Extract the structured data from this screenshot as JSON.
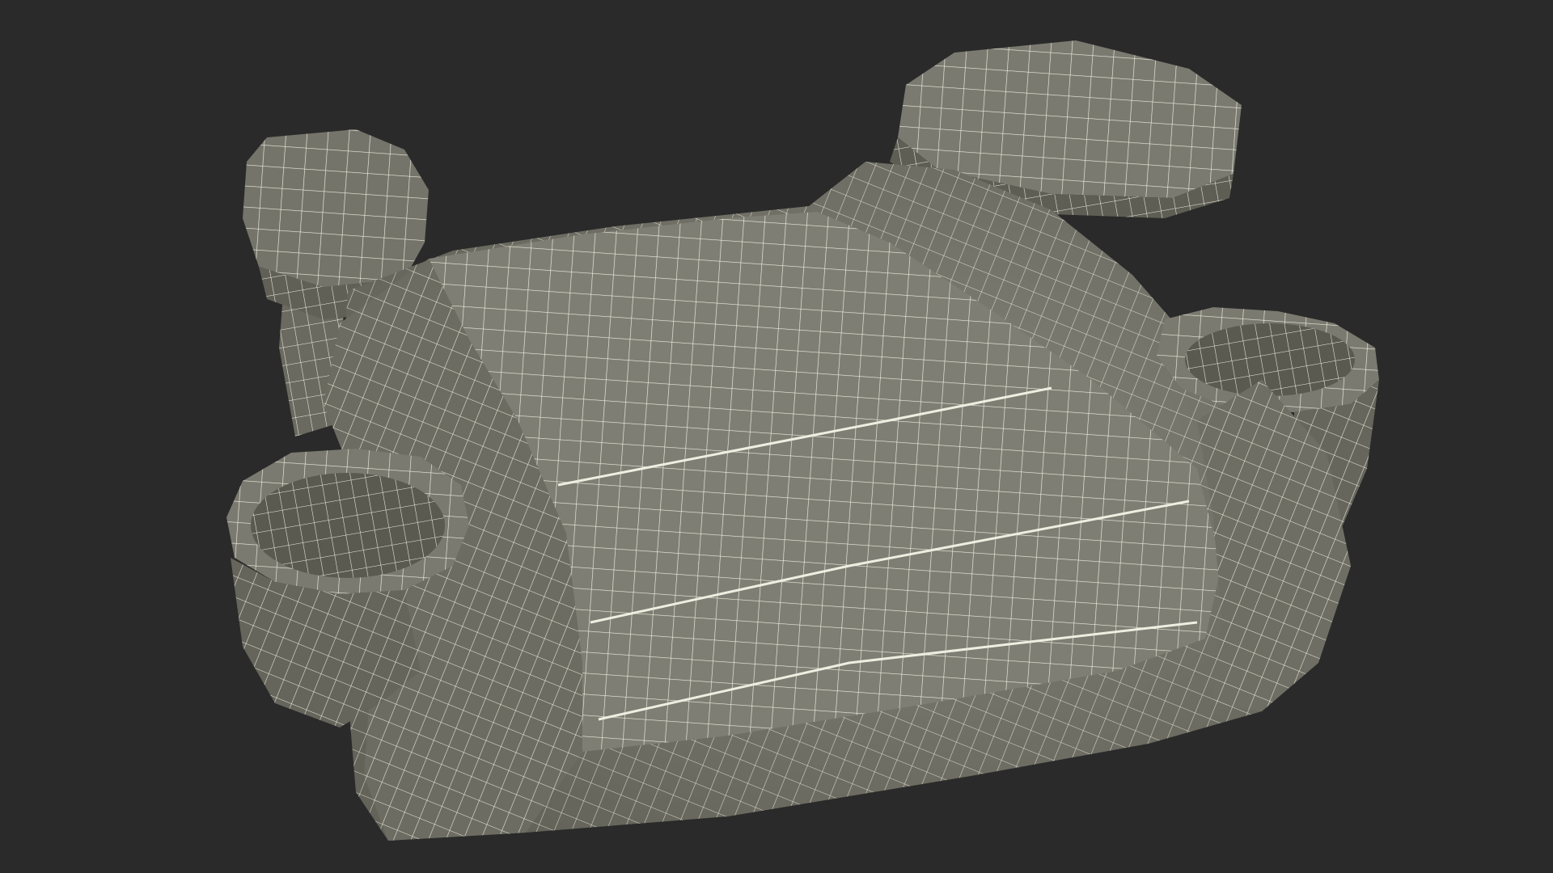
{
  "scene": {
    "background_color": "#2a2a2a",
    "surface_color": "#7a7a6e",
    "surface_shade_color": "#5f5f55",
    "surface_highlight_color": "#8a8a7e",
    "wire_color": "#efeee0",
    "object": "booster-seat-wireframe"
  }
}
